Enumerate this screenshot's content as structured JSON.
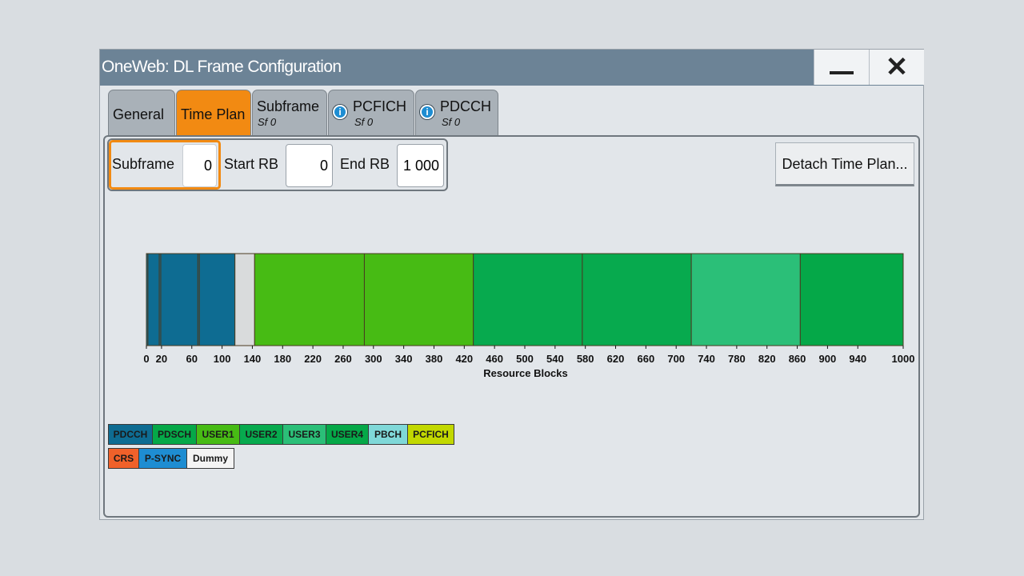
{
  "window": {
    "title": "OneWeb: DL Frame Configuration"
  },
  "tabs": [
    {
      "label": "General",
      "sub": ""
    },
    {
      "label": "Time Plan",
      "sub": ""
    },
    {
      "label": "Subframe",
      "sub": "Sf 0"
    },
    {
      "label": "PCFICH",
      "sub": "Sf 0",
      "info": "i"
    },
    {
      "label": "PDCCH",
      "sub": "Sf 0",
      "info": "i"
    }
  ],
  "params": {
    "subframe_label": "Subframe",
    "subframe_value": "0",
    "start_rb_label": "Start RB",
    "start_rb_value": "0",
    "end_rb_label": "End RB",
    "end_rb_value": "1 000"
  },
  "detach_label": "Detach Time Plan...",
  "chart_data": {
    "type": "bar",
    "xlabel": "Resource Blocks",
    "xlim": [
      0,
      1000
    ],
    "ticks": [
      0,
      20,
      60,
      100,
      140,
      180,
      220,
      260,
      300,
      340,
      380,
      420,
      460,
      500,
      540,
      580,
      620,
      660,
      700,
      740,
      780,
      820,
      860,
      900,
      940,
      1000
    ],
    "segments": [
      {
        "start": 0,
        "end": 2,
        "channel": "PDCCH",
        "color": "#0e6c92"
      },
      {
        "start": 2,
        "end": 17,
        "channel": "PDCCH",
        "color": "#0e6c92"
      },
      {
        "start": 17,
        "end": 19,
        "channel": "PDCCH",
        "color": "#0e6c92"
      },
      {
        "start": 19,
        "end": 68,
        "channel": "PDCCH",
        "color": "#0e6c92"
      },
      {
        "start": 68,
        "end": 70,
        "channel": "PDCCH",
        "color": "#0e6c92"
      },
      {
        "start": 70,
        "end": 117,
        "channel": "PDCCH",
        "color": "#0e6c92"
      },
      {
        "start": 117,
        "end": 143,
        "channel": "Dummy",
        "color": "#d9dbdc"
      },
      {
        "start": 143,
        "end": 288,
        "channel": "USER1",
        "color": "#47bb14"
      },
      {
        "start": 288,
        "end": 432,
        "channel": "USER1",
        "color": "#47bb14"
      },
      {
        "start": 432,
        "end": 576,
        "channel": "USER2",
        "color": "#07aa4e"
      },
      {
        "start": 576,
        "end": 720,
        "channel": "USER2",
        "color": "#07aa4e"
      },
      {
        "start": 720,
        "end": 864,
        "channel": "USER3",
        "color": "#2bbf78"
      },
      {
        "start": 864,
        "end": 1000,
        "channel": "USER4",
        "color": "#05a848"
      }
    ]
  },
  "legend_row1": [
    {
      "label": "PDCCH",
      "color": "#0e6c92"
    },
    {
      "label": "PDSCH",
      "color": "#05a848"
    },
    {
      "label": "USER1",
      "color": "#47bb14"
    },
    {
      "label": "USER2",
      "color": "#07aa4e"
    },
    {
      "label": "USER3",
      "color": "#2bbf78"
    },
    {
      "label": "USER4",
      "color": "#05a848"
    },
    {
      "label": "PBCH",
      "color": "#7fd8d8"
    },
    {
      "label": "PCFICH",
      "color": "#c2d800"
    }
  ],
  "legend_row2": [
    {
      "label": "CRS",
      "color": "#f0612a"
    },
    {
      "label": "P-SYNC",
      "color": "#1e8dd2"
    },
    {
      "label": "Dummy",
      "color": "#f4f4f4"
    }
  ]
}
